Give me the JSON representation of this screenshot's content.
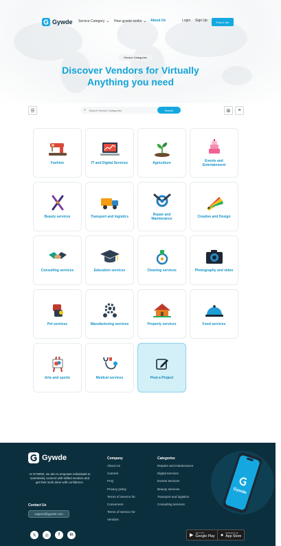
{
  "nav": {
    "brand": "Gywde",
    "links": [
      {
        "label": "Service Category",
        "dropdown": true
      },
      {
        "label": "How gywde works",
        "dropdown": true
      },
      {
        "label": "About Us",
        "dropdown": false
      }
    ],
    "login": "Login",
    "signup": "Sign Up",
    "post_job": "Post a Job"
  },
  "hero": {
    "badge": "Service Categories",
    "title_line1": "Discover Vendors for Virtually",
    "title_line2": "Anything you need"
  },
  "toolbar": {
    "search_placeholder": "Search Service Categories",
    "search_button": "Search"
  },
  "categories": [
    {
      "label": "Fashion",
      "icon": "sewing-machine-icon"
    },
    {
      "label": "IT and Digital Services",
      "icon": "laptop-chart-icon"
    },
    {
      "label": "Agriculture",
      "icon": "plant-sprout-icon"
    },
    {
      "label": "Events and Entertainment",
      "icon": "cake-icon"
    },
    {
      "label": "Beauty services",
      "icon": "beauty-tools-icon"
    },
    {
      "label": "Transport and logistics",
      "icon": "delivery-truck-icon"
    },
    {
      "label": "Repair and Maintenance",
      "icon": "wrench-gear-icon"
    },
    {
      "label": "Creative and Design",
      "icon": "color-swatch-icon"
    },
    {
      "label": "Consulting services",
      "icon": "handshake-icon"
    },
    {
      "label": "Education services",
      "icon": "graduation-cap-icon"
    },
    {
      "label": "Cleaning services",
      "icon": "cleaning-spray-icon"
    },
    {
      "label": "Photography and video",
      "icon": "camera-icon"
    },
    {
      "label": "Pet services",
      "icon": "pet-icon"
    },
    {
      "label": "Manufacturing services",
      "icon": "factory-gear-icon"
    },
    {
      "label": "Property services",
      "icon": "house-icon"
    },
    {
      "label": "Food services",
      "icon": "food-cloche-icon"
    },
    {
      "label": "Arts and sports",
      "icon": "easel-icon"
    },
    {
      "label": "Medical services",
      "icon": "stethoscope-icon"
    },
    {
      "label": "Post a Project",
      "icon": "edit-icon"
    }
  ],
  "footer": {
    "brand": "Gywde",
    "about": "At GYWDE, we aim to empower individuals to seamlessly connect with skilled vendors and get their work done with confidence.",
    "contact_heading": "Contact Us",
    "contact_email": "support@gywde.com",
    "company_heading": "Company",
    "company_links": [
      "About Us",
      "Careers",
      "FAQ",
      "Privacy policy",
      "Terms of Service for",
      "Consumers",
      "Terms of Service for",
      "Vendors"
    ],
    "categories_heading": "Categories",
    "category_links": [
      "Repairs and maintenance",
      "Digital services",
      "Events services",
      "Beauty services",
      "Transport and logistics",
      "Consulting services"
    ],
    "google_play_small": "GET IT ON",
    "google_play": "Google Play",
    "app_store_small": "Download on the",
    "app_store": "App Store",
    "phone_brand": "Gywde"
  },
  "colors": {
    "accent": "#15a8e0",
    "title": "#12a3d8",
    "footer_bg": "#0c2f3d",
    "post_card_bg": "#d3f0f8"
  }
}
